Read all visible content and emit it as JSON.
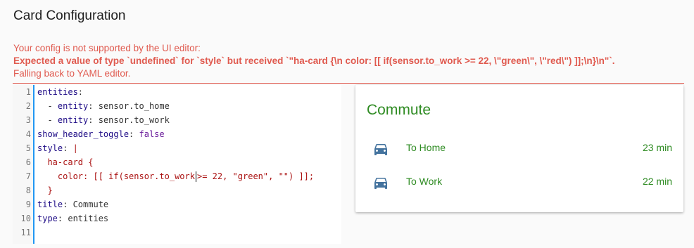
{
  "page": {
    "title": "Card Configuration"
  },
  "warning": {
    "line1": "Your config is not supported by the UI editor:",
    "line2": "Expected a value of type `undefined` for `style` but received `\"ha-card {\\n color: [[ if(sensor.to_work >= 22, \\\"green\\\", \\\"red\\\") ]];\\n}\\n\"`.",
    "line3": "Falling back to YAML editor.",
    "color": "#e05a4f"
  },
  "editor": {
    "accent": "#2196f3",
    "lines": [
      {
        "n": "1",
        "parts": [
          [
            "k",
            "entities"
          ],
          [
            "p",
            ":"
          ]
        ]
      },
      {
        "n": "2",
        "parts": [
          [
            "p",
            "  - "
          ],
          [
            "k",
            "entity"
          ],
          [
            "p",
            ": sensor.to_home"
          ]
        ]
      },
      {
        "n": "3",
        "parts": [
          [
            "p",
            "  - "
          ],
          [
            "k",
            "entity"
          ],
          [
            "p",
            ": sensor.to_work"
          ]
        ]
      },
      {
        "n": "4",
        "parts": [
          [
            "k",
            "show_header_toggle"
          ],
          [
            "p",
            ": "
          ],
          [
            "v",
            "false"
          ]
        ]
      },
      {
        "n": "5",
        "parts": [
          [
            "k",
            "style"
          ],
          [
            "p",
            ": "
          ],
          [
            "s",
            "|"
          ]
        ]
      },
      {
        "n": "6",
        "parts": [
          [
            "s",
            "  ha-card {"
          ]
        ]
      },
      {
        "n": "7",
        "parts": [
          [
            "s",
            "    color: [[ if(sensor.to_work"
          ],
          [
            "cursor",
            ""
          ],
          [
            "s",
            ">= 22, \"green\", \"\") ]];"
          ]
        ]
      },
      {
        "n": "8",
        "parts": [
          [
            "s",
            "  }"
          ]
        ]
      },
      {
        "n": "9",
        "parts": [
          [
            "k",
            "title"
          ],
          [
            "p",
            ": Commute"
          ]
        ]
      },
      {
        "n": "10",
        "parts": [
          [
            "k",
            "type"
          ],
          [
            "p",
            ": entities"
          ]
        ]
      },
      {
        "n": "11",
        "parts": []
      }
    ]
  },
  "card": {
    "title": "Commute",
    "color": "#2e8b22",
    "icon_color": "#44739e",
    "entities": [
      {
        "icon": "car-icon",
        "name": "To Home",
        "value": "23 min"
      },
      {
        "icon": "car-icon",
        "name": "To Work",
        "value": "22 min"
      }
    ]
  }
}
